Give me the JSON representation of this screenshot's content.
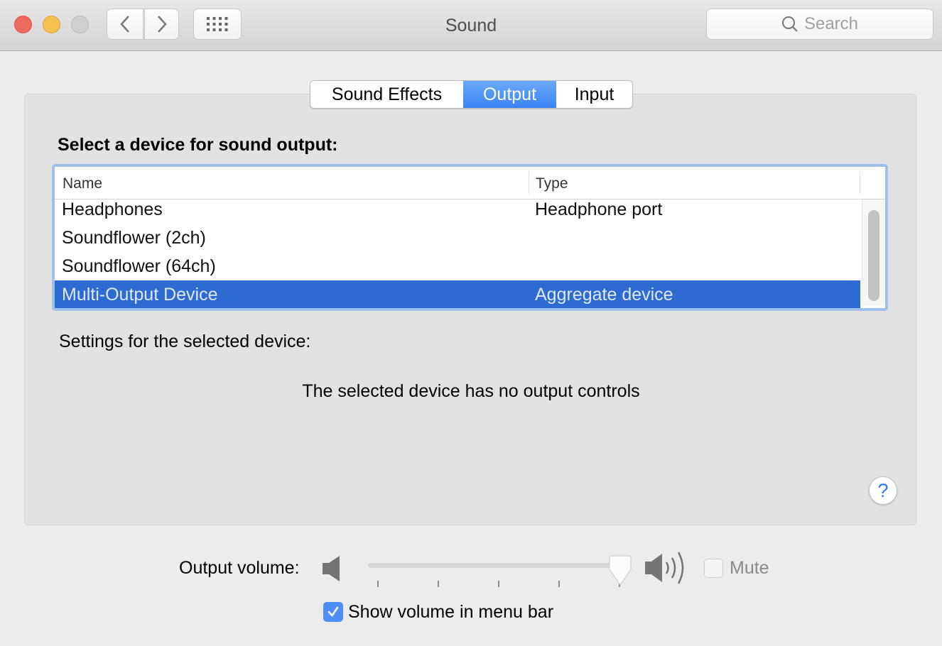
{
  "window": {
    "title": "Sound",
    "search_placeholder": "Search"
  },
  "tabs": [
    {
      "label": "Sound Effects",
      "selected": false
    },
    {
      "label": "Output",
      "selected": true
    },
    {
      "label": "Input",
      "selected": false
    }
  ],
  "output": {
    "heading": "Select a device for sound output:",
    "columns": {
      "name": "Name",
      "type": "Type"
    },
    "devices": [
      {
        "name": "Headphones",
        "type": "Headphone port",
        "selected": false
      },
      {
        "name": "Soundflower (2ch)",
        "type": "",
        "selected": false
      },
      {
        "name": "Soundflower (64ch)",
        "type": "",
        "selected": false
      },
      {
        "name": "Multi-Output Device",
        "type": "Aggregate device",
        "selected": true
      }
    ],
    "settings_label": "Settings for the selected device:",
    "no_controls_message": "The selected device has no output controls",
    "help_label": "?"
  },
  "volume": {
    "label": "Output volume:",
    "level_fraction": 1.0,
    "mute_label": "Mute",
    "mute_checked": false,
    "mute_enabled": false,
    "show_in_menu_bar_label": "Show volume in menu bar",
    "show_in_menu_bar_checked": true
  },
  "colors": {
    "accent": "#3b84f4",
    "selection": "#2d6bd2",
    "help_glyph": "#2f7cf6"
  }
}
